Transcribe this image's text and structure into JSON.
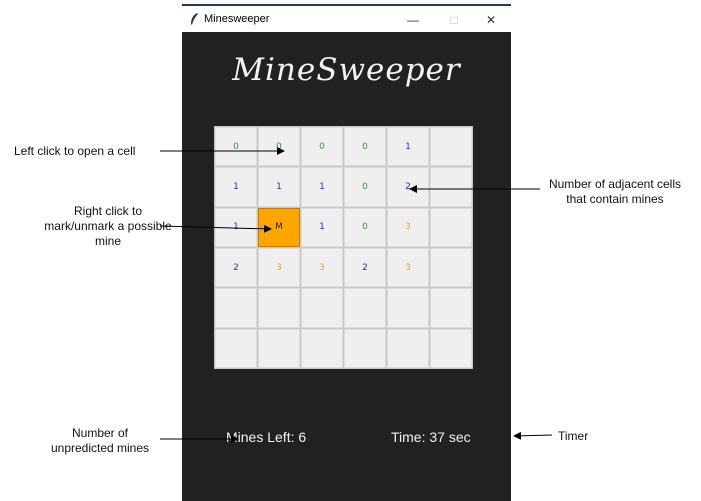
{
  "window": {
    "title": "Minesweeper",
    "minimize_glyph": "—",
    "maximize_glyph": "□",
    "close_glyph": "✕"
  },
  "game_title": "MineSweeper",
  "board": {
    "rows": [
      [
        "0",
        "0",
        "0",
        "0",
        "1",
        ""
      ],
      [
        "1",
        "1",
        "1",
        "0",
        "2",
        ""
      ],
      [
        "1",
        "M",
        "1",
        "0",
        "3",
        ""
      ],
      [
        "2",
        "3",
        "3",
        "2",
        "3",
        ""
      ],
      [
        "",
        "",
        "",
        "",
        "",
        ""
      ],
      [
        "",
        "",
        "",
        "",
        "",
        ""
      ]
    ],
    "colors": {
      "0": "#2e9b3a",
      "1": "#2a2ad1",
      "2": "#2a2ad1",
      "3": "#f0a020",
      "M": "#3a2000"
    },
    "flag_color": "#ffa500"
  },
  "status": {
    "mines_left": "Mines Left: 6",
    "timer": "Time: 37 sec"
  },
  "annotations": {
    "left_click": "Left click to open a cell",
    "right_click_line1": "Right click to",
    "right_click_line2": "mark/unmark a possible",
    "right_click_line3": "mine",
    "adjacent_line1": "Number of adjacent cells",
    "adjacent_line2": "that contain mines",
    "unpredicted_line1": "Number of",
    "unpredicted_line2": "unpredicted mines",
    "timer_label": "Timer"
  }
}
